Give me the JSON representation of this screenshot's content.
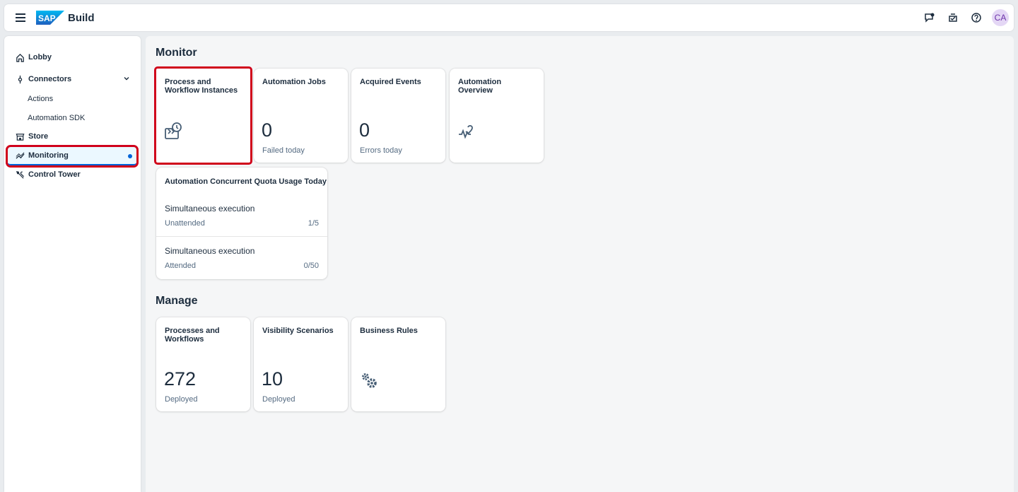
{
  "header": {
    "logo_text": "SAP",
    "product_name": "Build",
    "avatar_initials": "CA"
  },
  "nav": {
    "items": [
      {
        "label": "Lobby"
      },
      {
        "label": "Connectors"
      },
      {
        "label": "Actions"
      },
      {
        "label": "Automation SDK"
      },
      {
        "label": "Store"
      },
      {
        "label": "Monitoring"
      },
      {
        "label": "Control Tower"
      }
    ]
  },
  "monitor": {
    "section_title": "Monitor",
    "tiles": [
      {
        "title": "Process and Workflow Instances",
        "icon": "process-instances-icon"
      },
      {
        "title": "Automation Jobs",
        "value": "0",
        "subtitle": "Failed today"
      },
      {
        "title": "Acquired Events",
        "value": "0",
        "subtitle": "Errors today"
      },
      {
        "title": "Automation Overview",
        "icon": "heart-pulse-icon"
      }
    ],
    "quota": {
      "title": "Automation Concurrent Quota Usage Today",
      "rows": [
        {
          "label": "Simultaneous execution",
          "type": "Unattended",
          "value": "1/5"
        },
        {
          "label": "Simultaneous execution",
          "type": "Attended",
          "value": "0/50"
        }
      ]
    }
  },
  "manage": {
    "section_title": "Manage",
    "tiles": [
      {
        "title": "Processes and Workflows",
        "value": "272",
        "subtitle": "Deployed"
      },
      {
        "title": "Visibility Scenarios",
        "value": "10",
        "subtitle": "Deployed"
      },
      {
        "title": "Business Rules",
        "icon": "gears-icon"
      }
    ]
  },
  "colors": {
    "brand_blue": "#0070f2",
    "selection_red": "#d0021b",
    "selected_bg": "#ebf8ff",
    "avatar_bg": "#e4d7f5"
  }
}
